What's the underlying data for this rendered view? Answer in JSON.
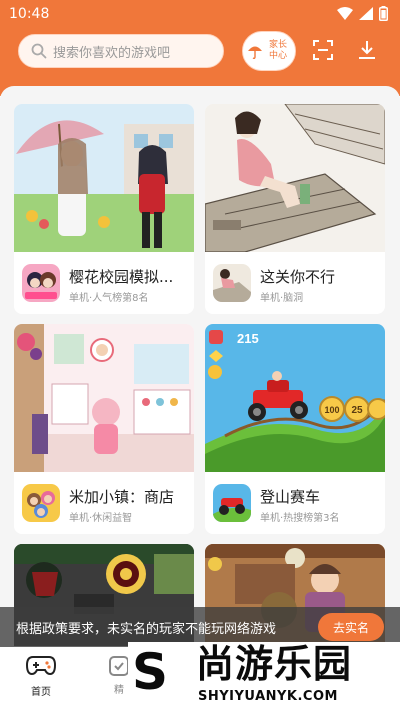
{
  "status_bar": {
    "time": "10:48"
  },
  "header": {
    "search_placeholder": "搜索你喜欢的游戏吧",
    "parent_center_label": "家长中心"
  },
  "games": [
    {
      "name": "樱花校园模拟...",
      "subtitle": "单机·人气榜第8名"
    },
    {
      "name": "这关你不行",
      "subtitle": "单机·脑洞"
    },
    {
      "name": "米加小镇：商店",
      "subtitle": "单机·休闲益智"
    },
    {
      "name": "登山赛车",
      "subtitle": "单机·热搜榜第3名"
    }
  ],
  "game4_hud": {
    "score": "215",
    "coins": [
      "100",
      "25"
    ]
  },
  "notice": {
    "text": "根据政策要求，未实名的玩家不能玩网络游戏",
    "button": "去实名"
  },
  "bottom_nav": {
    "home_label": "首页",
    "second_label": "精"
  },
  "watermark": {
    "letter": "S",
    "name": "尚游乐园",
    "url": "SHYIYUANYK.COM"
  },
  "colors": {
    "accent": "#f0773a",
    "feed_bg": "#f5f5f5",
    "notice_bg": "#3c3c3c"
  }
}
